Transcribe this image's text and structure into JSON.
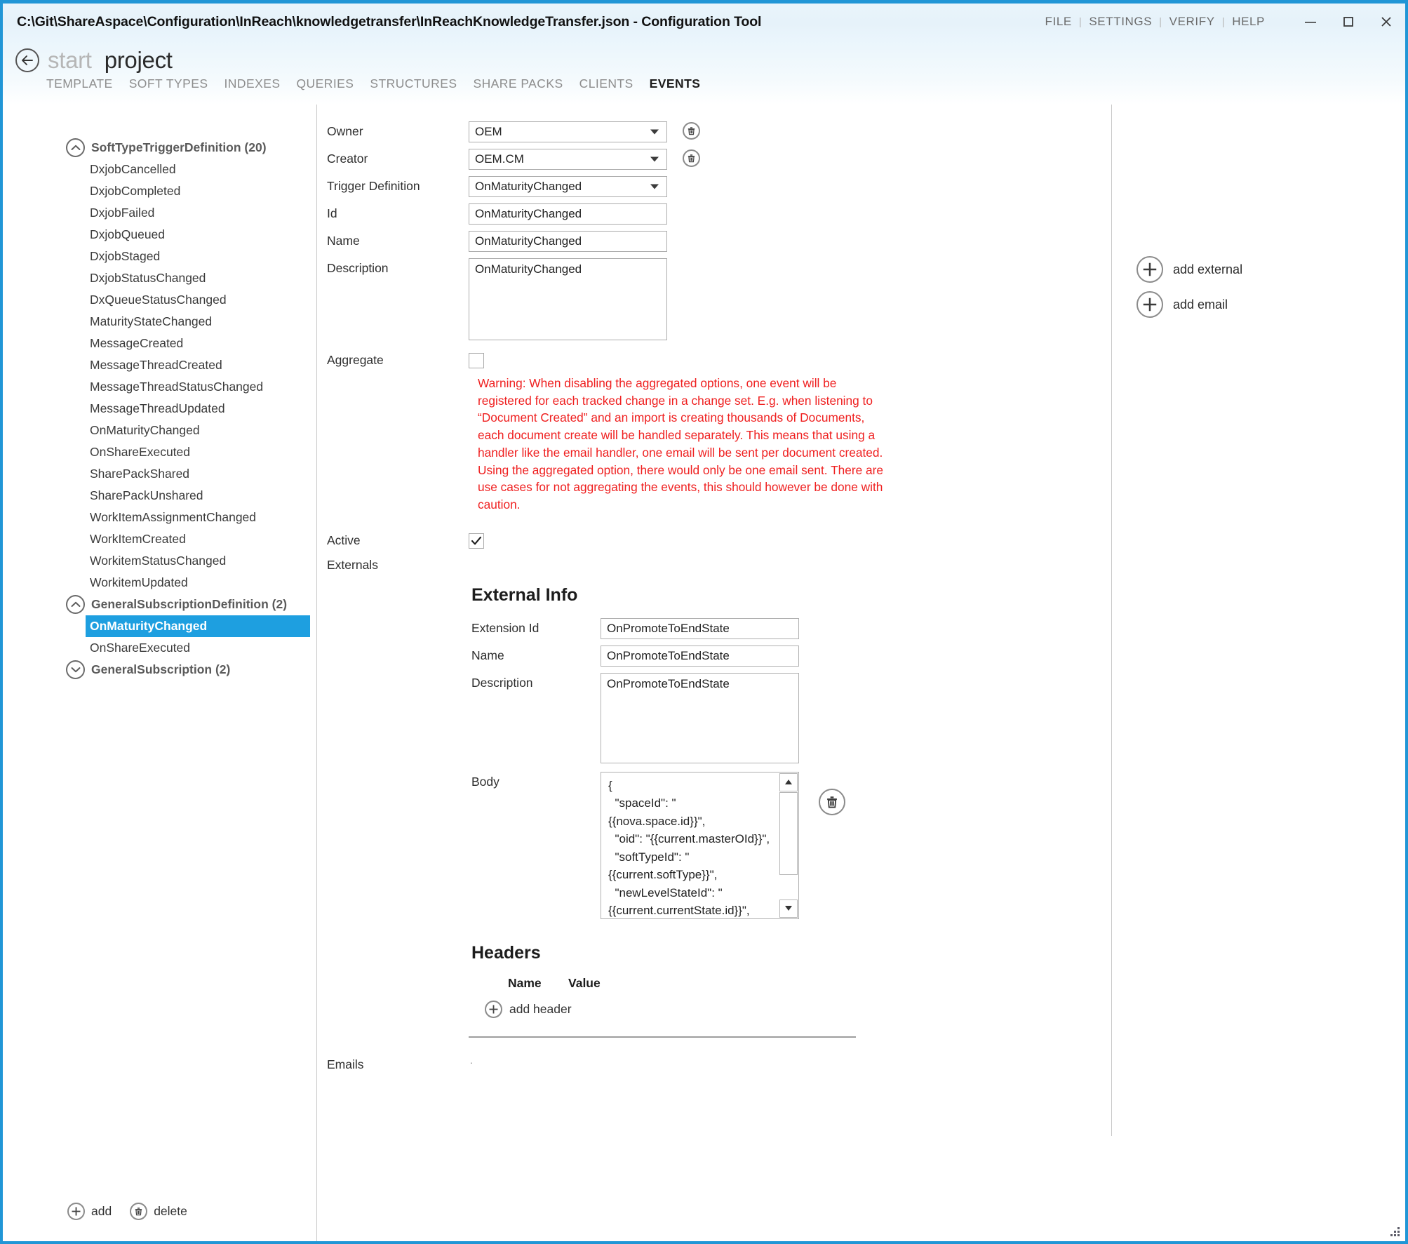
{
  "window": {
    "title": "C:\\Git\\ShareAspace\\Configuration\\InReach\\knowledgetransfer\\InReachKnowledgeTransfer.json - Configuration Tool",
    "menu": [
      "FILE",
      "SETTINGS",
      "VERIFY",
      "HELP"
    ],
    "separator": "|",
    "controls": {
      "minimize": "minimize-icon",
      "maximize": "maximize-icon",
      "close": "close-icon"
    },
    "accent_color": "#2196d6"
  },
  "header": {
    "back": "back-arrow-icon",
    "crumb_start": "start",
    "crumb_project": "project",
    "tabs": [
      {
        "label": "TEMPLATE",
        "active": false
      },
      {
        "label": "SOFT TYPES",
        "active": false
      },
      {
        "label": "INDEXES",
        "active": false
      },
      {
        "label": "QUERIES",
        "active": false
      },
      {
        "label": "STRUCTURES",
        "active": false
      },
      {
        "label": "SHARE PACKS",
        "active": false
      },
      {
        "label": "CLIENTS",
        "active": false
      },
      {
        "label": "EVENTS",
        "active": true
      }
    ]
  },
  "tree": {
    "groups": [
      {
        "label": "SoftTypeTriggerDefinition (20)",
        "expanded": true,
        "items": [
          "DxjobCancelled",
          "DxjobCompleted",
          "DxjobFailed",
          "DxjobQueued",
          "DxjobStaged",
          "DxjobStatusChanged",
          "DxQueueStatusChanged",
          "MaturityStateChanged",
          "MessageCreated",
          "MessageThreadCreated",
          "MessageThreadStatusChanged",
          "MessageThreadUpdated",
          "OnMaturityChanged",
          "OnShareExecuted",
          "SharePackShared",
          "SharePackUnshared",
          "WorkItemAssignmentChanged",
          "WorkItemCreated",
          "WorkitemStatusChanged",
          "WorkitemUpdated"
        ]
      },
      {
        "label": "GeneralSubscriptionDefinition (2)",
        "expanded": true,
        "items": [
          "OnMaturityChanged",
          "OnShareExecuted"
        ],
        "selected": "OnMaturityChanged"
      },
      {
        "label": "GeneralSubscription (2)",
        "expanded": false,
        "items": []
      }
    ],
    "footer": {
      "add_label": "add",
      "delete_label": "delete"
    }
  },
  "form": {
    "owner": {
      "label": "Owner",
      "value": "OEM"
    },
    "creator": {
      "label": "Creator",
      "value": "OEM.CM"
    },
    "trigger_definition": {
      "label": "Trigger Definition",
      "value": "OnMaturityChanged"
    },
    "id": {
      "label": "Id",
      "value": "OnMaturityChanged"
    },
    "name": {
      "label": "Name",
      "value": "OnMaturityChanged"
    },
    "description": {
      "label": "Description",
      "value": "OnMaturityChanged"
    },
    "aggregate": {
      "label": "Aggregate",
      "checked": false
    },
    "warning": "Warning: When disabling the aggregated options, one event will be registered for each tracked change in a change set. E.g. when listening to “Document Created” and an import is creating thousands of Documents, each document create will be handled separately. This means that using a handler like the email handler, one email will be sent per document created. Using the aggregated option, there would only be one email sent. There are use cases for not aggregating the events, this should however be done with caution.",
    "warning_color": "#ef2020",
    "active": {
      "label": "Active",
      "checked": true,
      "mark": "check-icon"
    },
    "externals_label": "Externals",
    "emails_label": "Emails",
    "emails_value": "."
  },
  "external_info": {
    "title": "External Info",
    "extension_id": {
      "label": "Extension Id",
      "value": "OnPromoteToEndState"
    },
    "name": {
      "label": "Name",
      "value": "OnPromoteToEndState"
    },
    "description": {
      "label": "Description",
      "value": "OnPromoteToEndState"
    },
    "body": {
      "label": "Body",
      "value": "{\n  \"spaceId\": \"{{nova.space.id}}\",\n  \"oid\": \"{{current.masterOId}}\",\n  \"softTypeId\": \"{{current.softType}}\",\n  \"newLevelStateId\": \"{{current.currentState.id}}\",\n  \"oldLevelStateId\": \"{{previous.currentState.id}}\""
    },
    "delete_icon": "trash-icon"
  },
  "headers": {
    "title": "Headers",
    "columns": [
      "Name",
      "Value"
    ],
    "rows": [],
    "add_label": "add header"
  },
  "right_panel": {
    "actions": [
      {
        "label": "add external",
        "icon": "plus-icon"
      },
      {
        "label": "add email",
        "icon": "plus-icon"
      }
    ]
  }
}
